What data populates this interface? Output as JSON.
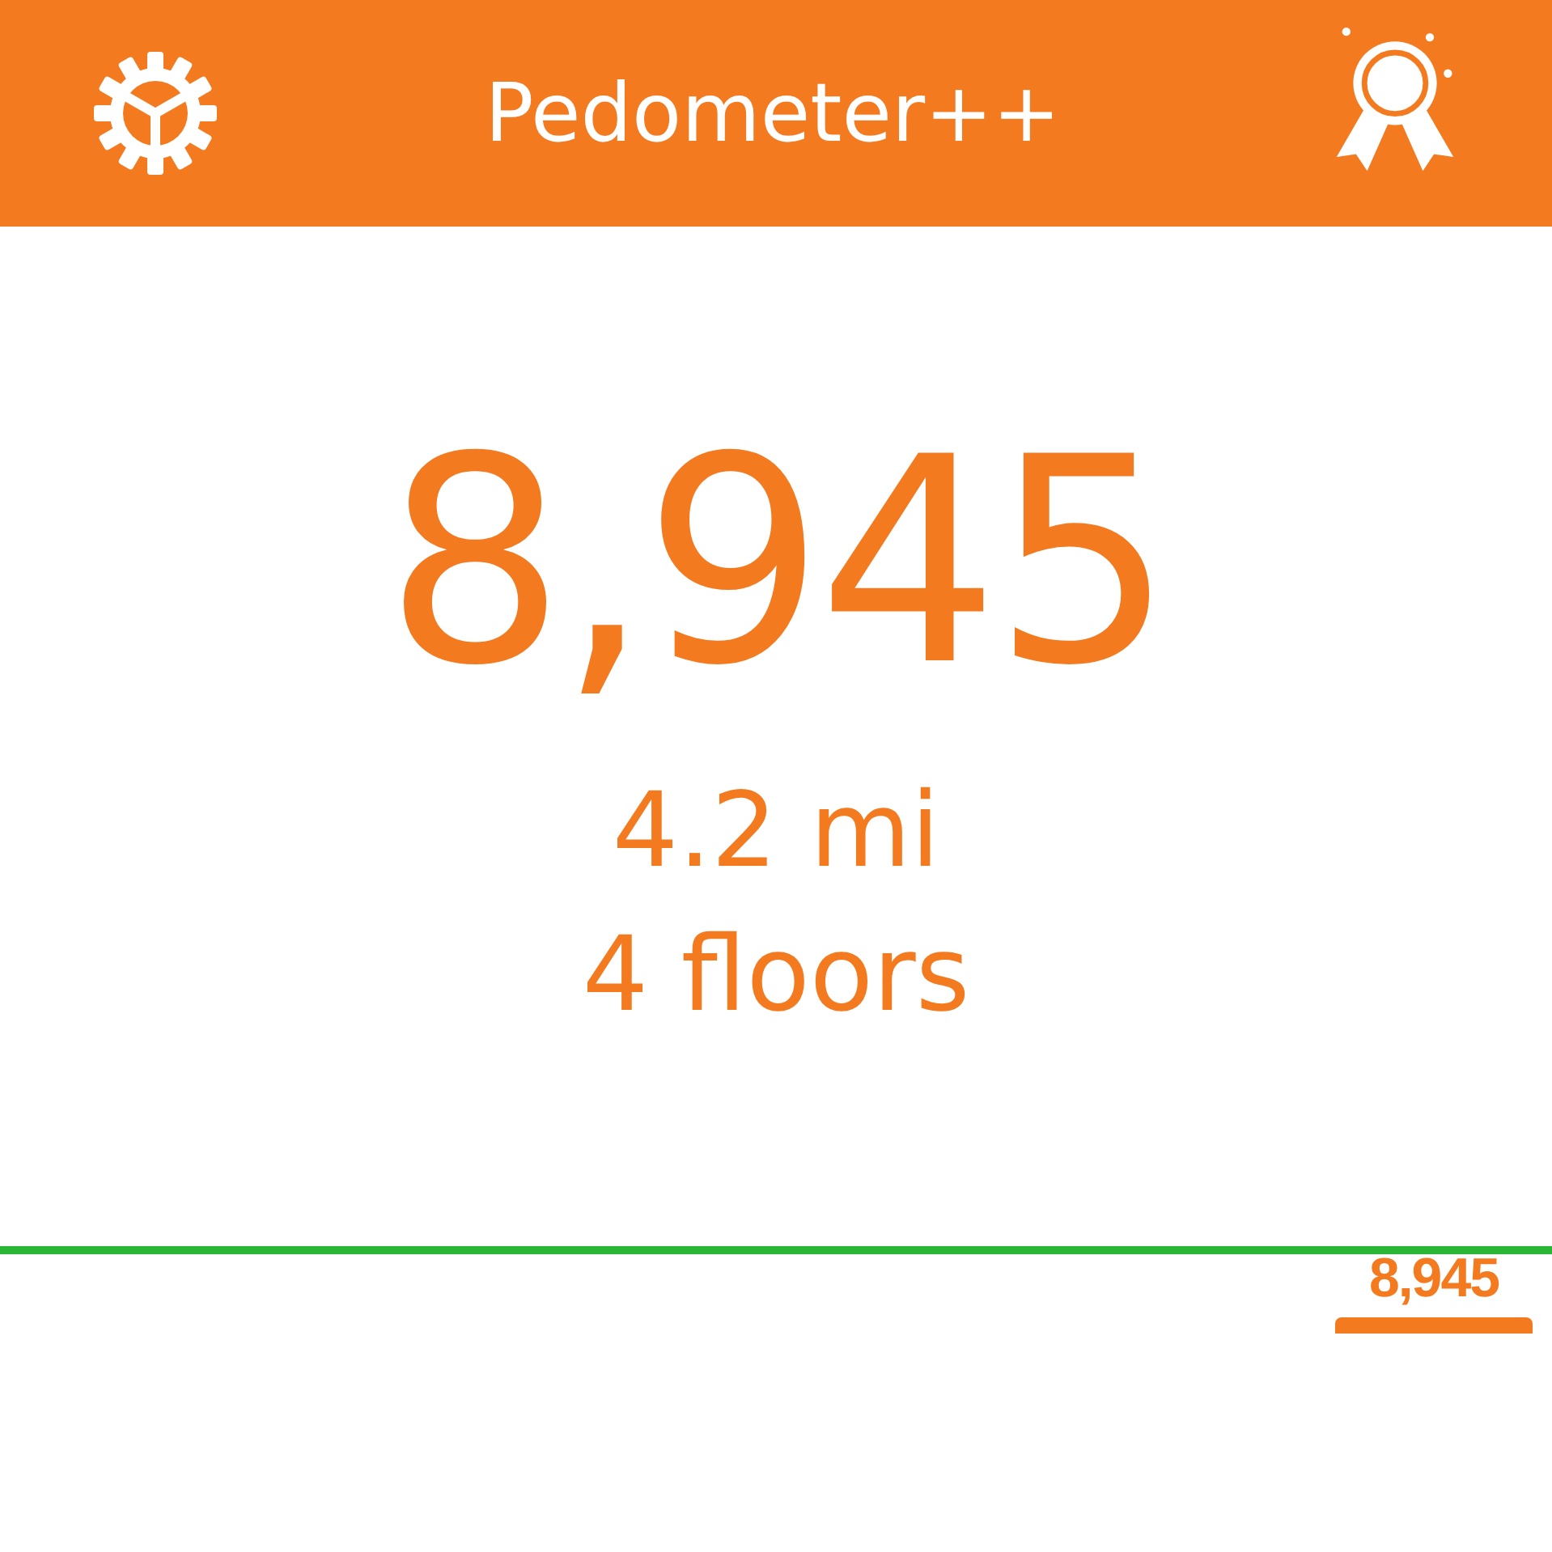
{
  "header": {
    "title": "Pedometer++"
  },
  "summary": {
    "steps": "8,945",
    "distance": "4.2 mi",
    "floors": "4 floors"
  },
  "history": {
    "bar_label": "8,945"
  }
}
